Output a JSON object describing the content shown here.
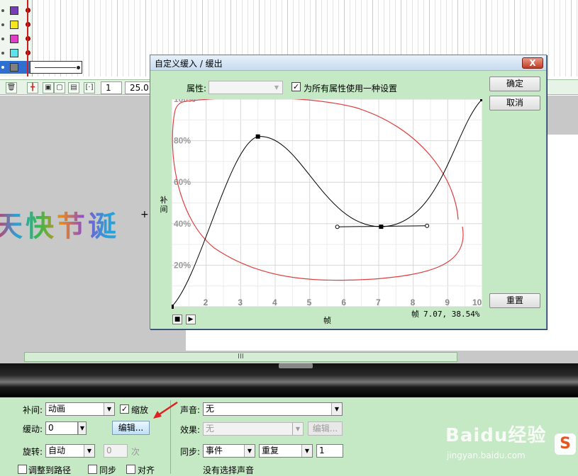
{
  "timeline": {
    "layer_swatch_colors": [
      "#7a3db8",
      "#f5e61e",
      "#e33ec8",
      "#5fe3e8",
      "#808080"
    ],
    "frame_field": "1",
    "fps_field": "25.0"
  },
  "stage": {
    "text": "天快节诞",
    "cursor_glyph": "+"
  },
  "hscroll": {
    "grip": "III"
  },
  "dialog": {
    "title": "自定义缓入 / 缓出",
    "close_glyph": "X",
    "property_label": "属性:",
    "property_value": "",
    "use_one_setting_label": "为所有属性使用一种设置",
    "use_one_setting_checked": "✓",
    "ok_button": "确定",
    "cancel_button": "取消",
    "reset_button": "重置",
    "axis_y_label": "补间",
    "axis_x_label": "帧",
    "readout_label": "帧",
    "readout_value": "7.07, 38.54%",
    "y_ticks": [
      "20%",
      "40%",
      "60%",
      "80%",
      "100%"
    ],
    "x_ticks": [
      "2",
      "3",
      "4",
      "5",
      "6",
      "7",
      "8",
      "9",
      "10"
    ],
    "stop_glyph": "■",
    "play_glyph": "▶"
  },
  "chart_data": {
    "type": "line",
    "title": "",
    "xlabel": "帧",
    "ylabel": "补间",
    "xlim": [
      1,
      10
    ],
    "ylim": [
      0,
      100
    ],
    "grid": true,
    "series": [
      {
        "values_x": [
          1,
          3.5,
          7.07,
          10
        ],
        "values_y": [
          0,
          82,
          38.54,
          100
        ]
      }
    ],
    "control_handles": [
      {
        "x": 5.8,
        "y": 38.5
      },
      {
        "x": 8.4,
        "y": 39
      }
    ],
    "annotation": "red hand-drawn ellipse around curve"
  },
  "properties": {
    "tween_label": "补间:",
    "tween_value": "动画",
    "scale_label": "缩放",
    "scale_checked": "✓",
    "ease_label": "缓动:",
    "ease_value": "0",
    "edit_button": "编辑...",
    "rotate_label": "旋转:",
    "rotate_value": "自动",
    "rotate_count": "0",
    "times_label": "次",
    "orient_to_path_label": "调整到路径",
    "sync_check_label": "同步",
    "snap_label": "对齐",
    "sound_label": "声音:",
    "sound_value": "无",
    "effect_label": "效果:",
    "effect_value": "无",
    "effect_edit_button": "编辑...",
    "sync_label": "同步:",
    "sync_value": "事件",
    "repeat_value": "重复",
    "repeat_count": "1",
    "no_sound_label": "没有选择声音"
  },
  "watermark": {
    "brand": "Baidu经验",
    "url": "jingyan.baidu.com",
    "s_badge": "S"
  }
}
